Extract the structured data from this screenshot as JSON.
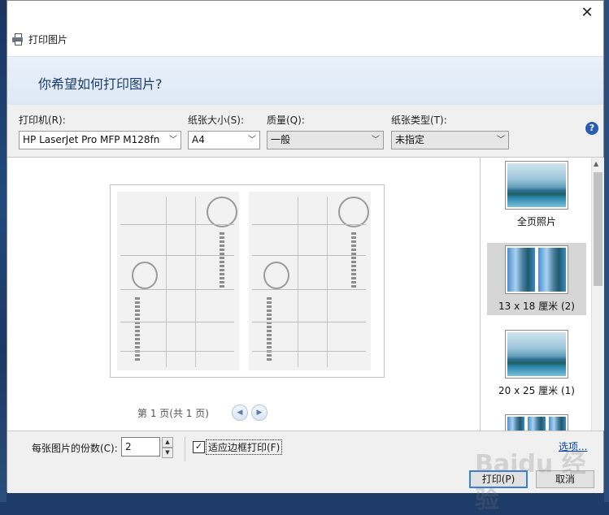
{
  "window": {
    "title": "打印图片",
    "close_symbol": "✕"
  },
  "header": {
    "question": "你希望如何打印图片?"
  },
  "controls": {
    "printer": {
      "label": "打印机(R):",
      "value": "HP LaserJet Pro MFP M128fn"
    },
    "paper_size": {
      "label": "纸张大小(S):",
      "value": "A4"
    },
    "quality": {
      "label": "质量(Q):",
      "value": "一般"
    },
    "paper_type": {
      "label": "纸张类型(T):",
      "value": "未指定"
    },
    "help_symbol": "?"
  },
  "preview": {
    "pager_text": "第 1 页(共 1 页)",
    "prev_symbol": "◀",
    "next_symbol": "▶"
  },
  "layouts": [
    {
      "caption": "全页照片",
      "selected": false
    },
    {
      "caption": "13 x 18 厘米 (2)",
      "selected": true
    },
    {
      "caption": "20 x 25 厘米 (1)",
      "selected": false
    }
  ],
  "bottom": {
    "copies_label": "每张图片的份数(C):",
    "copies_value": "2",
    "fit_label": "适应边框打印(F)",
    "fit_checked": true,
    "options_link": "选项...",
    "print_button": "打印(P)",
    "cancel_button": "取消"
  },
  "watermark": "Baidu 经验",
  "colors": {
    "accent": "#3c7fd6",
    "header_text": "#1b3c6a",
    "link": "#0645ad"
  }
}
